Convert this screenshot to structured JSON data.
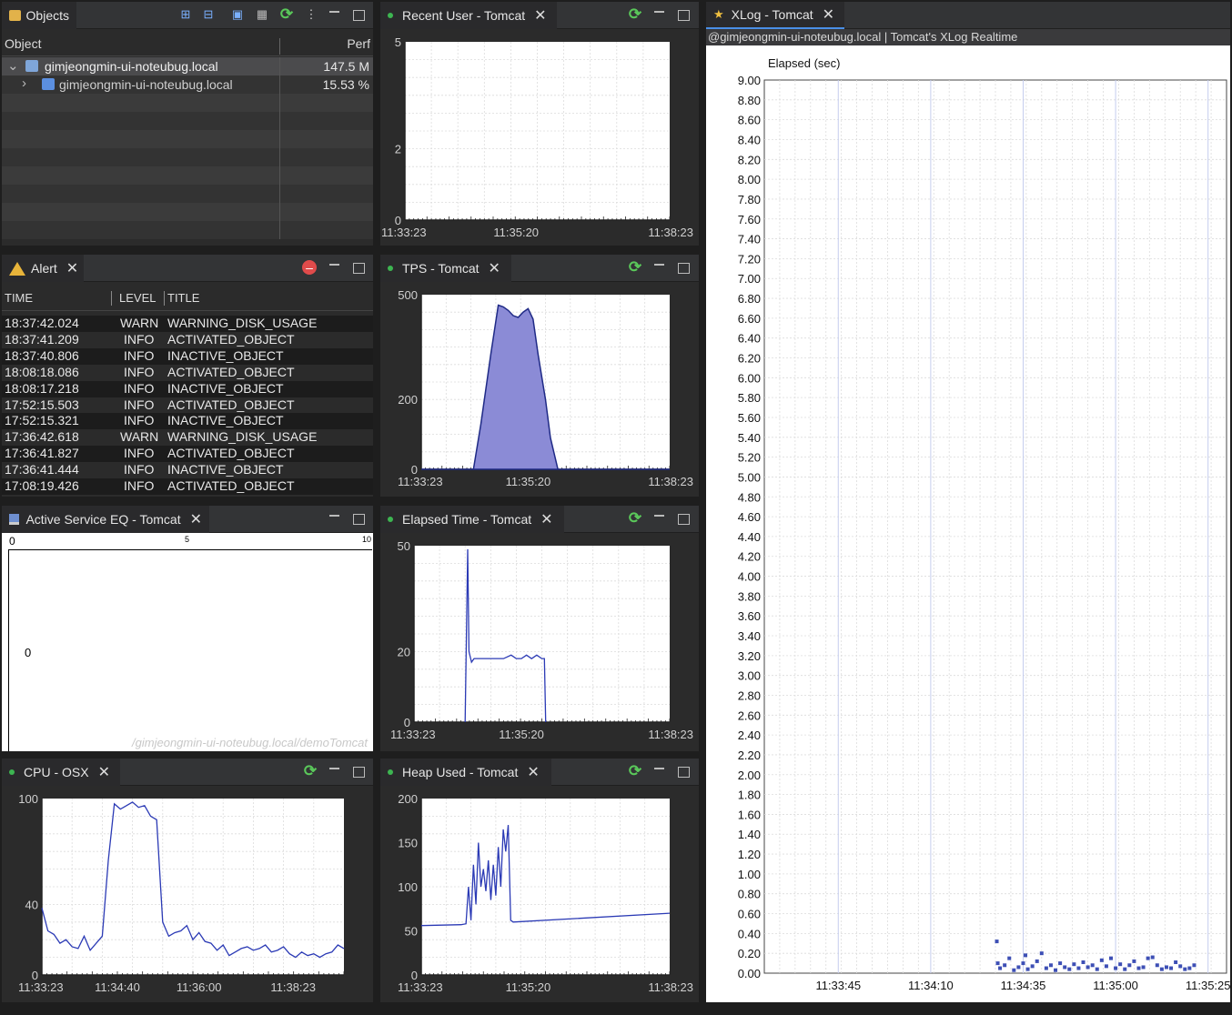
{
  "objects": {
    "tab_label": "Objects",
    "col_object": "Object",
    "col_perf": "Perf",
    "rows": [
      {
        "name": "gimjeongmin-ui-noteubug.local",
        "perf": "147.5 M"
      },
      {
        "name": "gimjeongmin-ui-noteubug.local",
        "perf": "15.53 %"
      }
    ]
  },
  "alert": {
    "tab_label": "Alert",
    "col_time": "TIME",
    "col_level": "LEVEL",
    "col_title": "TITLE",
    "rows": [
      {
        "time": "18:37:42.024",
        "level": "WARN",
        "title": "WARNING_DISK_USAGE"
      },
      {
        "time": "18:37:41.209",
        "level": "INFO",
        "title": "ACTIVATED_OBJECT"
      },
      {
        "time": "18:37:40.806",
        "level": "INFO",
        "title": "INACTIVE_OBJECT"
      },
      {
        "time": "18:08:18.086",
        "level": "INFO",
        "title": "ACTIVATED_OBJECT"
      },
      {
        "time": "18:08:17.218",
        "level": "INFO",
        "title": "INACTIVE_OBJECT"
      },
      {
        "time": "17:52:15.503",
        "level": "INFO",
        "title": "ACTIVATED_OBJECT"
      },
      {
        "time": "17:52:15.321",
        "level": "INFO",
        "title": "INACTIVE_OBJECT"
      },
      {
        "time": "17:36:42.618",
        "level": "WARN",
        "title": "WARNING_DISK_USAGE"
      },
      {
        "time": "17:36:41.827",
        "level": "INFO",
        "title": "ACTIVATED_OBJECT"
      },
      {
        "time": "17:36:41.444",
        "level": "INFO",
        "title": "INACTIVE_OBJECT"
      },
      {
        "time": "17:08:19.426",
        "level": "INFO",
        "title": "ACTIVATED_OBJECT"
      }
    ]
  },
  "active_service": {
    "tab_label": "Active Service EQ - Tomcat",
    "scale": [
      "0",
      "5",
      "10"
    ],
    "value": "0",
    "path": "/gimjeongmin-ui-noteubug.local/demoTomcat"
  },
  "tabs": {
    "recent_user": "Recent User - Tomcat",
    "tps": "TPS - Tomcat",
    "elapsed": "Elapsed Time - Tomcat",
    "cpu": "CPU - OSX",
    "heap": "Heap Used - Tomcat",
    "xlog": "XLog - Tomcat"
  },
  "xlog": {
    "subtitle": "@gimjeongmin-ui-noteubug.local | Tomcat's XLog Realtime",
    "ylabel": "Elapsed (sec)"
  },
  "chart_data": [
    {
      "id": "recent_user",
      "type": "line",
      "x_ticks": [
        "11:33:23",
        "11:35:20",
        "11:38:23"
      ],
      "y_ticks": [
        "5",
        "2",
        "0"
      ],
      "ylim": [
        0,
        5
      ],
      "series": [
        {
          "values": []
        }
      ]
    },
    {
      "id": "tps",
      "type": "area",
      "x_ticks": [
        "11:33:23",
        "11:35:20",
        "11:38:23"
      ],
      "y_ticks": [
        "500",
        "200",
        "0"
      ],
      "ylim": [
        0,
        500
      ],
      "color": "#8b8bd6",
      "x": [
        0,
        0.21,
        0.24,
        0.28,
        0.31,
        0.33,
        0.35,
        0.37,
        0.39,
        0.41,
        0.43,
        0.45,
        0.47,
        0.5,
        0.52,
        0.55,
        1.0
      ],
      "values": [
        0,
        0,
        130,
        330,
        470,
        465,
        455,
        440,
        435,
        450,
        460,
        430,
        330,
        200,
        90,
        0,
        0
      ]
    },
    {
      "id": "elapsed",
      "type": "line",
      "x_ticks": [
        "11:33:23",
        "11:35:20",
        "11:38:23"
      ],
      "y_ticks": [
        "50",
        "20",
        "0"
      ],
      "ylim": [
        0,
        50
      ],
      "x": [
        0.2,
        0.21,
        0.215,
        0.225,
        0.235,
        0.25,
        0.3,
        0.35,
        0.38,
        0.4,
        0.42,
        0.44,
        0.46,
        0.48,
        0.5,
        0.51,
        0.515
      ],
      "values": [
        0,
        49,
        20,
        17,
        18,
        18,
        18,
        18,
        19,
        18,
        18,
        19,
        18,
        19,
        18,
        18,
        0
      ]
    },
    {
      "id": "cpu",
      "type": "line",
      "x_ticks": [
        "11:33:23",
        "11:34:40",
        "11:36:00",
        "11:38:23"
      ],
      "y_ticks": [
        "100",
        "40",
        "0"
      ],
      "ylim": [
        0,
        100
      ],
      "x": [
        0,
        0.02,
        0.04,
        0.06,
        0.08,
        0.1,
        0.12,
        0.14,
        0.16,
        0.18,
        0.2,
        0.22,
        0.24,
        0.26,
        0.28,
        0.3,
        0.32,
        0.34,
        0.36,
        0.38,
        0.4,
        0.42,
        0.44,
        0.46,
        0.48,
        0.5,
        0.52,
        0.54,
        0.56,
        0.58,
        0.6,
        0.62,
        0.64,
        0.66,
        0.68,
        0.7,
        0.72,
        0.74,
        0.76,
        0.78,
        0.8,
        0.82,
        0.84,
        0.86,
        0.88,
        0.9,
        0.92,
        0.94,
        0.96,
        0.98,
        1.0
      ],
      "values": [
        38,
        25,
        23,
        18,
        20,
        16,
        15,
        22,
        14,
        18,
        22,
        65,
        97,
        94,
        96,
        98,
        95,
        96,
        90,
        88,
        30,
        22,
        24,
        25,
        28,
        20,
        24,
        19,
        18,
        14,
        17,
        11,
        13,
        15,
        16,
        14,
        15,
        17,
        13,
        14,
        16,
        12,
        10,
        13,
        11,
        12,
        10,
        12,
        13,
        17,
        15
      ]
    },
    {
      "id": "heap",
      "type": "line",
      "x_ticks": [
        "11:33:23",
        "11:35:20",
        "11:38:23"
      ],
      "y_ticks": [
        "200",
        "150",
        "100",
        "50",
        "0"
      ],
      "ylim": [
        0,
        200
      ],
      "x": [
        0,
        0.16,
        0.18,
        0.19,
        0.2,
        0.21,
        0.22,
        0.23,
        0.24,
        0.25,
        0.26,
        0.27,
        0.28,
        0.29,
        0.3,
        0.31,
        0.32,
        0.33,
        0.34,
        0.35,
        0.36,
        0.37,
        1.0
      ],
      "values": [
        56,
        57,
        58,
        100,
        62,
        125,
        80,
        150,
        100,
        120,
        95,
        130,
        85,
        125,
        90,
        145,
        100,
        165,
        140,
        170,
        62,
        60,
        70
      ]
    },
    {
      "id": "xlog",
      "type": "scatter",
      "x_ticks": [
        "11:33:45",
        "11:34:10",
        "11:34:35",
        "11:35:00",
        "11:35:25"
      ],
      "y_ticks": [
        "9.00",
        "8.80",
        "8.60",
        "8.40",
        "8.20",
        "8.00",
        "7.80",
        "7.60",
        "7.40",
        "7.20",
        "7.00",
        "6.80",
        "6.60",
        "6.40",
        "6.20",
        "6.00",
        "5.80",
        "5.60",
        "5.40",
        "5.20",
        "5.00",
        "4.80",
        "4.60",
        "4.40",
        "4.20",
        "4.00",
        "3.80",
        "3.60",
        "3.40",
        "3.20",
        "3.00",
        "2.80",
        "2.60",
        "2.40",
        "2.20",
        "2.00",
        "1.80",
        "1.60",
        "1.40",
        "1.20",
        "1.00",
        "0.80",
        "0.60",
        "0.40",
        "0.20",
        "0.00"
      ],
      "ylim": [
        0,
        9
      ],
      "color": "#3d4fb5",
      "points": [
        [
          0.503,
          0.32
        ],
        [
          0.505,
          0.1
        ],
        [
          0.51,
          0.05
        ],
        [
          0.52,
          0.08
        ],
        [
          0.53,
          0.15
        ],
        [
          0.54,
          0.03
        ],
        [
          0.55,
          0.06
        ],
        [
          0.56,
          0.1
        ],
        [
          0.565,
          0.18
        ],
        [
          0.57,
          0.04
        ],
        [
          0.58,
          0.07
        ],
        [
          0.59,
          0.12
        ],
        [
          0.6,
          0.2
        ],
        [
          0.61,
          0.05
        ],
        [
          0.62,
          0.08
        ],
        [
          0.63,
          0.03
        ],
        [
          0.64,
          0.1
        ],
        [
          0.65,
          0.06
        ],
        [
          0.66,
          0.04
        ],
        [
          0.67,
          0.09
        ],
        [
          0.68,
          0.05
        ],
        [
          0.69,
          0.11
        ],
        [
          0.7,
          0.06
        ],
        [
          0.71,
          0.08
        ],
        [
          0.72,
          0.04
        ],
        [
          0.73,
          0.13
        ],
        [
          0.74,
          0.07
        ],
        [
          0.75,
          0.15
        ],
        [
          0.76,
          0.05
        ],
        [
          0.77,
          0.09
        ],
        [
          0.78,
          0.04
        ],
        [
          0.79,
          0.08
        ],
        [
          0.8,
          0.12
        ],
        [
          0.81,
          0.05
        ],
        [
          0.82,
          0.06
        ],
        [
          0.83,
          0.15
        ],
        [
          0.84,
          0.16
        ],
        [
          0.85,
          0.08
        ],
        [
          0.86,
          0.04
        ],
        [
          0.87,
          0.06
        ],
        [
          0.88,
          0.05
        ],
        [
          0.89,
          0.11
        ],
        [
          0.9,
          0.07
        ],
        [
          0.91,
          0.04
        ],
        [
          0.92,
          0.05
        ],
        [
          0.93,
          0.08
        ]
      ]
    }
  ]
}
